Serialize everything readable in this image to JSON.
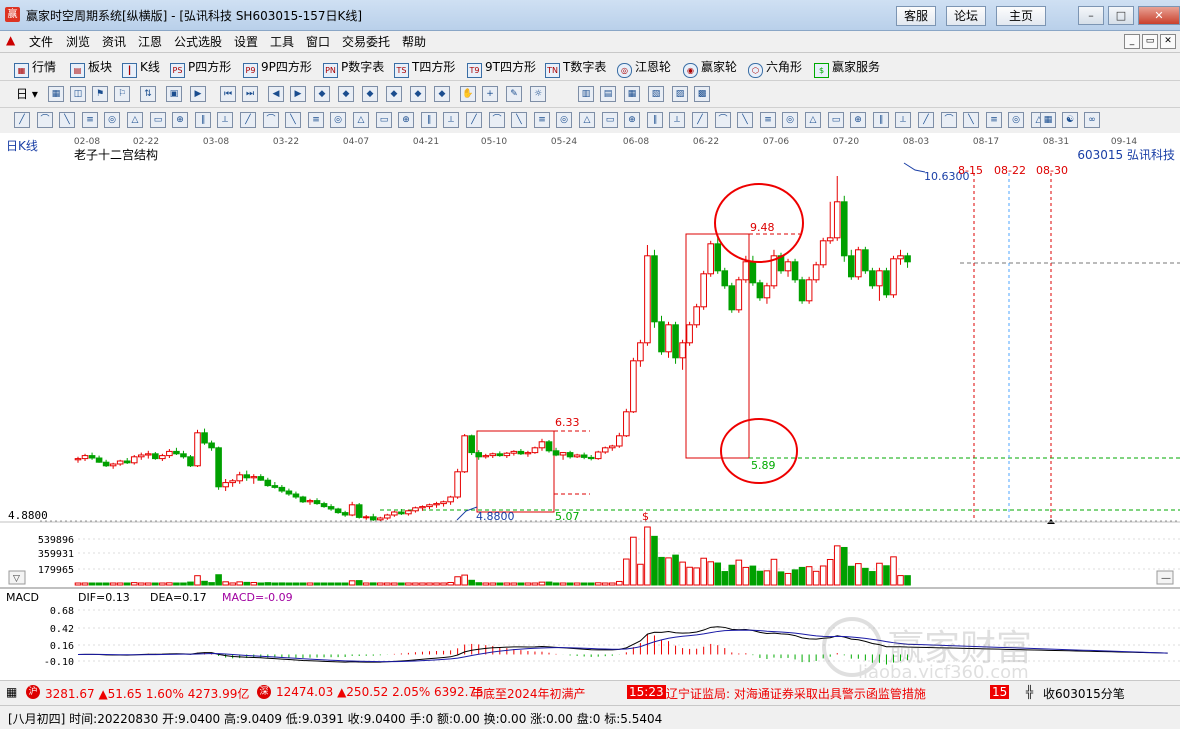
{
  "window": {
    "title": "赢家时空周期系统[纵横版] - [弘讯科技  SH603015-157日K线]",
    "buttons": [
      "客服",
      "论坛",
      "主页"
    ],
    "min": "–",
    "max": "□",
    "close": "✕"
  },
  "menu": [
    "文件",
    "浏览",
    "资讯",
    "江恩",
    "公式选股",
    "设置",
    "工具",
    "窗口",
    "交易委托",
    "帮助"
  ],
  "toolbar1": [
    {
      "label": "行情",
      "icon": "grid-icon"
    },
    {
      "label": "板块",
      "icon": "blocks-icon"
    },
    {
      "label": "K线",
      "icon": "candlestick-icon"
    },
    {
      "label": "P四方形",
      "icon": "ps-square-icon"
    },
    {
      "label": "9P四方形",
      "icon": "p9-square-icon"
    },
    {
      "label": "P数字表",
      "icon": "pn-table-icon"
    },
    {
      "label": "T四方形",
      "icon": "ts-square-icon"
    },
    {
      "label": "9T四方形",
      "icon": "t9-square-icon"
    },
    {
      "label": "T数字表",
      "icon": "tn-table-icon"
    },
    {
      "label": "江恩轮",
      "icon": "gann-wheel-icon"
    },
    {
      "label": "赢家轮",
      "icon": "winner-wheel-icon"
    },
    {
      "label": "六角形",
      "icon": "hexagon-icon"
    },
    {
      "label": "赢家服务",
      "icon": "dollar-icon"
    }
  ],
  "toolbar2_first": "日",
  "chart_panel": {
    "timeframe_label": "日K线",
    "indicator_name": "老子十二宫结构",
    "stock_label": "603015 弘讯科技",
    "date_axis": [
      "02-08",
      "02-22",
      "03-08",
      "03-22",
      "04-07",
      "04-21",
      "05-10",
      "05-24",
      "06-08",
      "06-22",
      "07-06",
      "07-20",
      "08-03",
      "08-17",
      "08-31",
      "09-14"
    ],
    "price_axis_label": "4.8800",
    "annotations": [
      "10.6300",
      "9.48",
      "6.33",
      "5.89",
      "5.07",
      "4.8800",
      "8-15",
      "08-22",
      "08-30"
    ],
    "volume_axis": [
      "539896",
      "359931",
      "179965"
    ],
    "macd_panel": {
      "name": "MACD",
      "dif": "DIF=0.13",
      "dea": "DEA=0.17",
      "macd": "MACD=-0.09",
      "axis": [
        "0.68",
        "0.42",
        "0.16",
        "-0.10"
      ]
    },
    "watermark_text": "赢家财富",
    "watermark_url": "liaoba.yjcf360.com"
  },
  "chart_data": {
    "type": "candlestick",
    "title": "老子十二宫结构",
    "symbol": "603015 弘讯科技",
    "colors": {
      "up": "#e60000",
      "down": "#00a000"
    },
    "candles": [
      [
        5.9,
        5.95,
        5.85,
        5.92
      ],
      [
        5.92,
        6.0,
        5.88,
        5.97
      ],
      [
        5.97,
        6.02,
        5.9,
        5.93
      ],
      [
        5.93,
        5.97,
        5.85,
        5.86
      ],
      [
        5.86,
        5.9,
        5.78,
        5.8
      ],
      [
        5.8,
        5.85,
        5.75,
        5.83
      ],
      [
        5.83,
        5.9,
        5.8,
        5.88
      ],
      [
        5.88,
        5.93,
        5.83,
        5.85
      ],
      [
        5.85,
        5.98,
        5.82,
        5.95
      ],
      [
        5.95,
        6.02,
        5.9,
        5.98
      ],
      [
        5.98,
        6.05,
        5.92,
        6.0
      ],
      [
        6.0,
        6.03,
        5.9,
        5.92
      ],
      [
        5.92,
        6.0,
        5.88,
        5.97
      ],
      [
        5.97,
        6.08,
        5.93,
        6.04
      ],
      [
        6.04,
        6.1,
        5.98,
        6.0
      ],
      [
        6.0,
        6.05,
        5.92,
        5.95
      ],
      [
        5.95,
        5.98,
        5.78,
        5.8
      ],
      [
        5.8,
        6.4,
        5.78,
        6.35
      ],
      [
        6.35,
        6.42,
        6.15,
        6.18
      ],
      [
        6.18,
        6.22,
        6.05,
        6.1
      ],
      [
        6.1,
        6.12,
        5.4,
        5.45
      ],
      [
        5.45,
        5.58,
        5.38,
        5.52
      ],
      [
        5.52,
        5.58,
        5.45,
        5.55
      ],
      [
        5.55,
        5.7,
        5.5,
        5.65
      ],
      [
        5.65,
        5.72,
        5.55,
        5.6
      ],
      [
        5.6,
        5.66,
        5.5,
        5.62
      ],
      [
        5.62,
        5.66,
        5.55,
        5.56
      ],
      [
        5.56,
        5.6,
        5.45,
        5.47
      ],
      [
        5.47,
        5.53,
        5.42,
        5.44
      ],
      [
        5.44,
        5.48,
        5.35,
        5.38
      ],
      [
        5.38,
        5.42,
        5.3,
        5.33
      ],
      [
        5.33,
        5.37,
        5.25,
        5.28
      ],
      [
        5.28,
        5.3,
        5.18,
        5.2
      ],
      [
        5.2,
        5.25,
        5.15,
        5.22
      ],
      [
        5.22,
        5.26,
        5.15,
        5.17
      ],
      [
        5.17,
        5.2,
        5.1,
        5.12
      ],
      [
        5.12,
        5.16,
        5.05,
        5.08
      ],
      [
        5.08,
        5.1,
        5.0,
        5.02
      ],
      [
        5.02,
        5.05,
        4.95,
        4.98
      ],
      [
        4.98,
        5.2,
        4.96,
        5.15
      ],
      [
        5.15,
        5.18,
        4.92,
        4.94
      ],
      [
        4.94,
        4.98,
        4.9,
        4.95
      ],
      [
        4.95,
        5.0,
        4.88,
        4.9
      ],
      [
        4.9,
        4.95,
        4.88,
        4.93
      ],
      [
        4.93,
        5.0,
        4.9,
        4.98
      ],
      [
        4.98,
        5.05,
        4.95,
        5.03
      ],
      [
        5.03,
        5.08,
        4.98,
        5.0
      ],
      [
        5.0,
        5.07,
        4.97,
        5.05
      ],
      [
        5.05,
        5.12,
        5.02,
        5.1
      ],
      [
        5.1,
        5.14,
        5.05,
        5.12
      ],
      [
        5.12,
        5.17,
        5.08,
        5.15
      ],
      [
        5.15,
        5.2,
        5.1,
        5.17
      ],
      [
        5.17,
        5.22,
        5.12,
        5.2
      ],
      [
        5.2,
        5.3,
        5.15,
        5.28
      ],
      [
        5.28,
        5.75,
        5.25,
        5.7
      ],
      [
        5.7,
        6.33,
        5.68,
        6.3
      ],
      [
        6.3,
        6.32,
        5.98,
        6.02
      ],
      [
        6.02,
        6.06,
        5.9,
        5.95
      ],
      [
        5.95,
        6.0,
        5.92,
        5.97
      ],
      [
        5.97,
        6.02,
        5.93,
        6.0
      ],
      [
        6.0,
        6.04,
        5.95,
        5.97
      ],
      [
        5.97,
        6.03,
        5.93,
        6.01
      ],
      [
        6.01,
        6.06,
        5.97,
        6.04
      ],
      [
        6.04,
        6.08,
        5.98,
        6.0
      ],
      [
        6.0,
        6.05,
        5.95,
        6.02
      ],
      [
        6.02,
        6.12,
        6.0,
        6.1
      ],
      [
        6.1,
        6.25,
        6.05,
        6.2
      ],
      [
        6.2,
        6.23,
        6.02,
        6.05
      ],
      [
        6.05,
        6.1,
        5.96,
        5.98
      ],
      [
        5.98,
        6.03,
        5.9,
        6.02
      ],
      [
        6.02,
        6.05,
        5.92,
        5.95
      ],
      [
        5.95,
        6.0,
        5.93,
        5.98
      ],
      [
        5.98,
        6.02,
        5.91,
        5.94
      ],
      [
        5.94,
        5.98,
        5.89,
        5.92
      ],
      [
        5.92,
        6.05,
        5.9,
        6.03
      ],
      [
        6.03,
        6.12,
        6.0,
        6.1
      ],
      [
        6.1,
        6.15,
        6.05,
        6.13
      ],
      [
        6.13,
        6.35,
        6.1,
        6.3
      ],
      [
        6.3,
        6.75,
        6.28,
        6.7
      ],
      [
        6.7,
        7.6,
        6.68,
        7.55
      ],
      [
        7.55,
        7.9,
        7.45,
        7.85
      ],
      [
        7.85,
        9.48,
        7.8,
        9.3
      ],
      [
        9.3,
        9.4,
        8.1,
        8.2
      ],
      [
        8.2,
        8.3,
        7.65,
        7.7
      ],
      [
        7.7,
        8.2,
        7.6,
        8.15
      ],
      [
        8.15,
        8.2,
        7.5,
        7.6
      ],
      [
        7.6,
        7.9,
        7.4,
        7.85
      ],
      [
        7.85,
        8.2,
        7.8,
        8.15
      ],
      [
        8.15,
        8.5,
        8.1,
        8.45
      ],
      [
        8.45,
        9.05,
        8.4,
        9.0
      ],
      [
        9.0,
        9.55,
        8.95,
        9.5
      ],
      [
        9.5,
        9.6,
        9.0,
        9.05
      ],
      [
        9.05,
        9.1,
        8.75,
        8.8
      ],
      [
        8.8,
        8.85,
        8.35,
        8.4
      ],
      [
        8.4,
        8.95,
        8.35,
        8.9
      ],
      [
        8.9,
        9.3,
        8.85,
        9.2
      ],
      [
        9.2,
        9.3,
        8.8,
        8.85
      ],
      [
        8.85,
        8.9,
        8.55,
        8.6
      ],
      [
        8.6,
        8.85,
        8.5,
        8.8
      ],
      [
        8.8,
        9.4,
        8.75,
        9.3
      ],
      [
        9.3,
        9.35,
        9.0,
        9.05
      ],
      [
        9.05,
        9.25,
        8.95,
        9.2
      ],
      [
        9.2,
        9.25,
        8.85,
        8.9
      ],
      [
        8.9,
        8.95,
        8.5,
        8.55
      ],
      [
        8.55,
        8.95,
        8.5,
        8.9
      ],
      [
        8.9,
        9.2,
        8.85,
        9.15
      ],
      [
        9.15,
        9.6,
        9.1,
        9.55
      ],
      [
        9.55,
        10.2,
        9.5,
        9.6
      ],
      [
        9.6,
        10.63,
        9.55,
        10.2
      ],
      [
        10.2,
        10.3,
        9.2,
        9.3
      ],
      [
        9.3,
        9.4,
        8.9,
        8.95
      ],
      [
        8.95,
        9.45,
        8.9,
        9.4
      ],
      [
        9.4,
        9.45,
        9.0,
        9.05
      ],
      [
        9.05,
        9.1,
        8.75,
        8.8
      ],
      [
        8.8,
        9.1,
        8.55,
        9.05
      ],
      [
        9.05,
        9.1,
        8.6,
        8.65
      ],
      [
        8.65,
        9.3,
        8.6,
        9.25
      ],
      [
        9.25,
        9.4,
        9.15,
        9.3
      ],
      [
        9.3,
        9.35,
        9.1,
        9.2
      ]
    ],
    "volume_max": 539896,
    "key_levels": {
      "high": 10.63,
      "box_high": 9.48,
      "box_low": 5.89,
      "box1_high": 6.33,
      "box1_low": 5.07,
      "low": 4.88
    },
    "macd": {
      "dif": 0.13,
      "dea": 0.17,
      "macd": -0.09,
      "ylim": [
        -0.1,
        0.68
      ]
    }
  },
  "status": {
    "sh_icon": "沪",
    "sh": "3281.67 ▲51.65 1.60% 4273.99亿",
    "sz_icon": "深",
    "sz": "12474.03 ▲250.52 2.05% 6392.75",
    "news1": "年底至2024年初满产",
    "time": "15:23",
    "news2": "辽宁证监局: 对海通证券采取出具警示函监管措施",
    "tail": "15",
    "recv": "收603015分笔"
  },
  "bottom": "[八月初四] 时间:20220830 开:9.0400 高:9.0409 低:9.0391 收:9.0400 手:0 额:0.00 换:0.00 涨:0.00 盘:0 标:5.5404"
}
